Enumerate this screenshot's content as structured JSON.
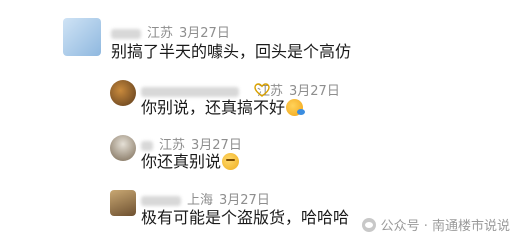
{
  "comments": [
    {
      "region": "江苏",
      "date": "3月27日",
      "text": "别搞了半天的噱头，回头是个高仿"
    },
    {
      "region": "江苏",
      "date": "3月27日",
      "text": "你别说，还真搞不好"
    },
    {
      "region": "江苏",
      "date": "3月27日",
      "text": "你还真别说"
    },
    {
      "region": "上海",
      "date": "3月27日",
      "text": "极有可能是个盗版货，哈哈哈"
    }
  ],
  "watermark": {
    "text": "公众号 · 南通楼市说说"
  },
  "colors": {
    "meta": "#8e8e8e",
    "like_icon": "#d9a100"
  },
  "icons": {
    "reply1_emoji": "grinning-face-emoji",
    "reply2_emoji": "thinking-face-emoji",
    "like": "heart-outline-icon"
  }
}
